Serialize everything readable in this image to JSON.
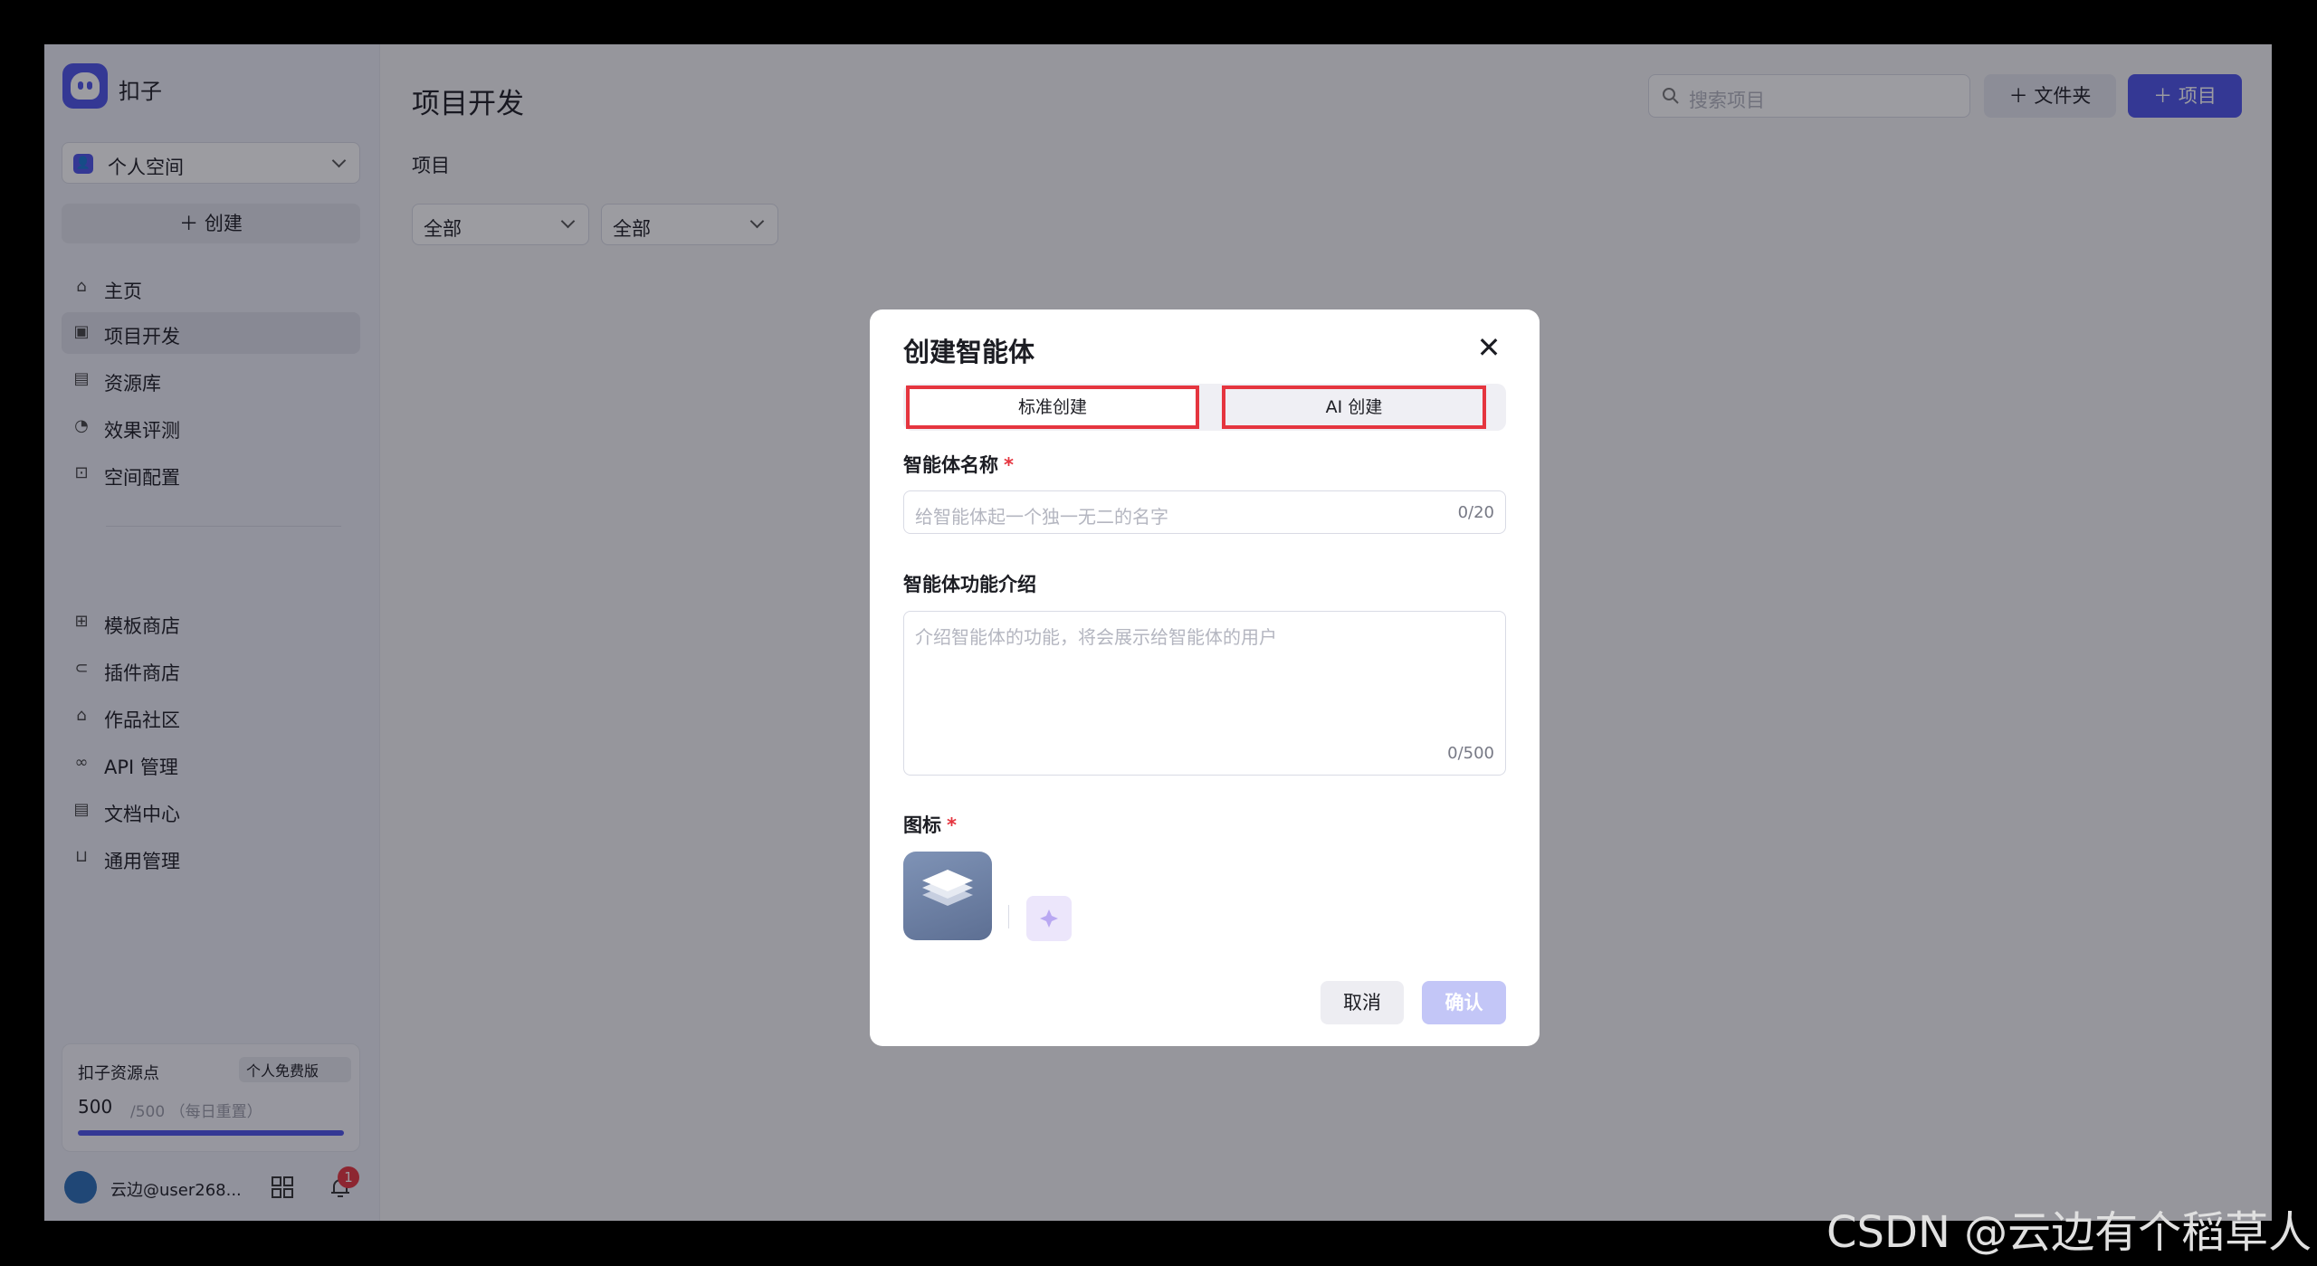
{
  "app": {
    "name": "扣子"
  },
  "sidebar": {
    "space_label": "个人空间",
    "space_icon": "👤",
    "create_label": "创建",
    "nav_primary": [
      {
        "label": "主页",
        "icon": "home-icon",
        "active": false
      },
      {
        "label": "项目开发",
        "icon": "bot-icon",
        "active": true
      },
      {
        "label": "资源库",
        "icon": "library-icon",
        "active": false
      },
      {
        "label": "效果评测",
        "icon": "gauge-icon",
        "active": false
      },
      {
        "label": "空间配置",
        "icon": "terminal-icon",
        "active": false
      }
    ],
    "nav_secondary": [
      {
        "label": "模板商店",
        "icon": "template-icon"
      },
      {
        "label": "插件商店",
        "icon": "plugin-icon"
      },
      {
        "label": "作品社区",
        "icon": "community-icon"
      },
      {
        "label": "API 管理",
        "icon": "link-icon"
      },
      {
        "label": "文档中心",
        "icon": "document-icon"
      },
      {
        "label": "通用管理",
        "icon": "inbox-icon"
      }
    ],
    "resource": {
      "title": "扣子资源点",
      "badge": "个人免费版",
      "used": "500",
      "total": "/500 （每日重置）",
      "fill_fraction": 1.0
    },
    "user": {
      "name": "云边@user268...",
      "notification_count": "1"
    }
  },
  "main": {
    "title": "项目开发",
    "section": "项目",
    "filters": [
      "全部",
      "全部"
    ],
    "search_placeholder": "搜索项目",
    "folder_label": "文件夹",
    "project_label": "项目"
  },
  "modal": {
    "title": "创建智能体",
    "close": "✕",
    "tabs": [
      "标准创建",
      "AI 创建"
    ],
    "name_label": "智能体名称",
    "name_placeholder": "给智能体起一个独一无二的名字",
    "name_counter": "0/20",
    "desc_label": "智能体功能介绍",
    "desc_placeholder": "介绍智能体的功能，将会展示给智能体的用户",
    "desc_counter": "0/500",
    "icon_label": "图标",
    "required_mark": "*",
    "cancel_label": "取消",
    "confirm_label": "确认"
  },
  "watermark": "CSDN @云边有个稻草人",
  "colors": {
    "accent": "#4d53e8",
    "highlight": "#e5353f",
    "confirm_disabled": "#c3c6f7"
  }
}
